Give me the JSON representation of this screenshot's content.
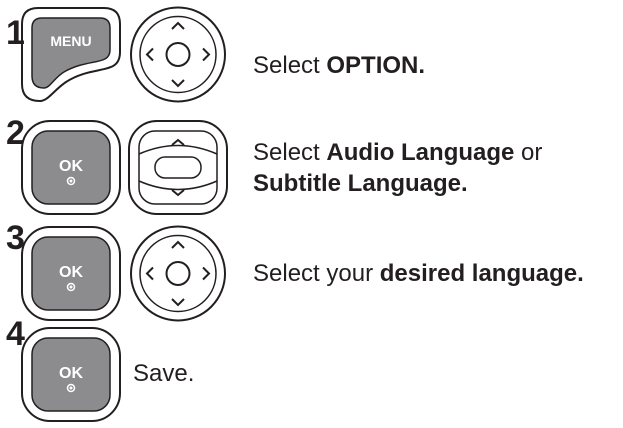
{
  "steps": [
    {
      "number": "1",
      "buttons": [
        "menu-button",
        "nav-pad-4way"
      ],
      "button_labels": {
        "menu": "MENU"
      },
      "text": {
        "pre": "Select ",
        "bold": "OPTION.",
        "post": ""
      }
    },
    {
      "number": "2",
      "buttons": [
        "ok-button",
        "nav-pad-updown"
      ],
      "button_labels": {
        "ok": "OK"
      },
      "text": {
        "pre": "Select ",
        "bold": "Audio Language",
        "post": " or",
        "line2_bold": "Subtitle Language."
      }
    },
    {
      "number": "3",
      "buttons": [
        "ok-button",
        "nav-pad-4way"
      ],
      "button_labels": {
        "ok": "OK"
      },
      "text": {
        "pre": "Select your ",
        "bold": "desired language.",
        "post": ""
      }
    },
    {
      "number": "4",
      "buttons": [
        "ok-button"
      ],
      "button_labels": {
        "ok": "OK"
      },
      "text": {
        "pre": "Save.",
        "bold": "",
        "post": ""
      }
    }
  ],
  "colors": {
    "button_fill": "#8c8c8e",
    "outline": "#231f20",
    "text": "#231f20"
  }
}
